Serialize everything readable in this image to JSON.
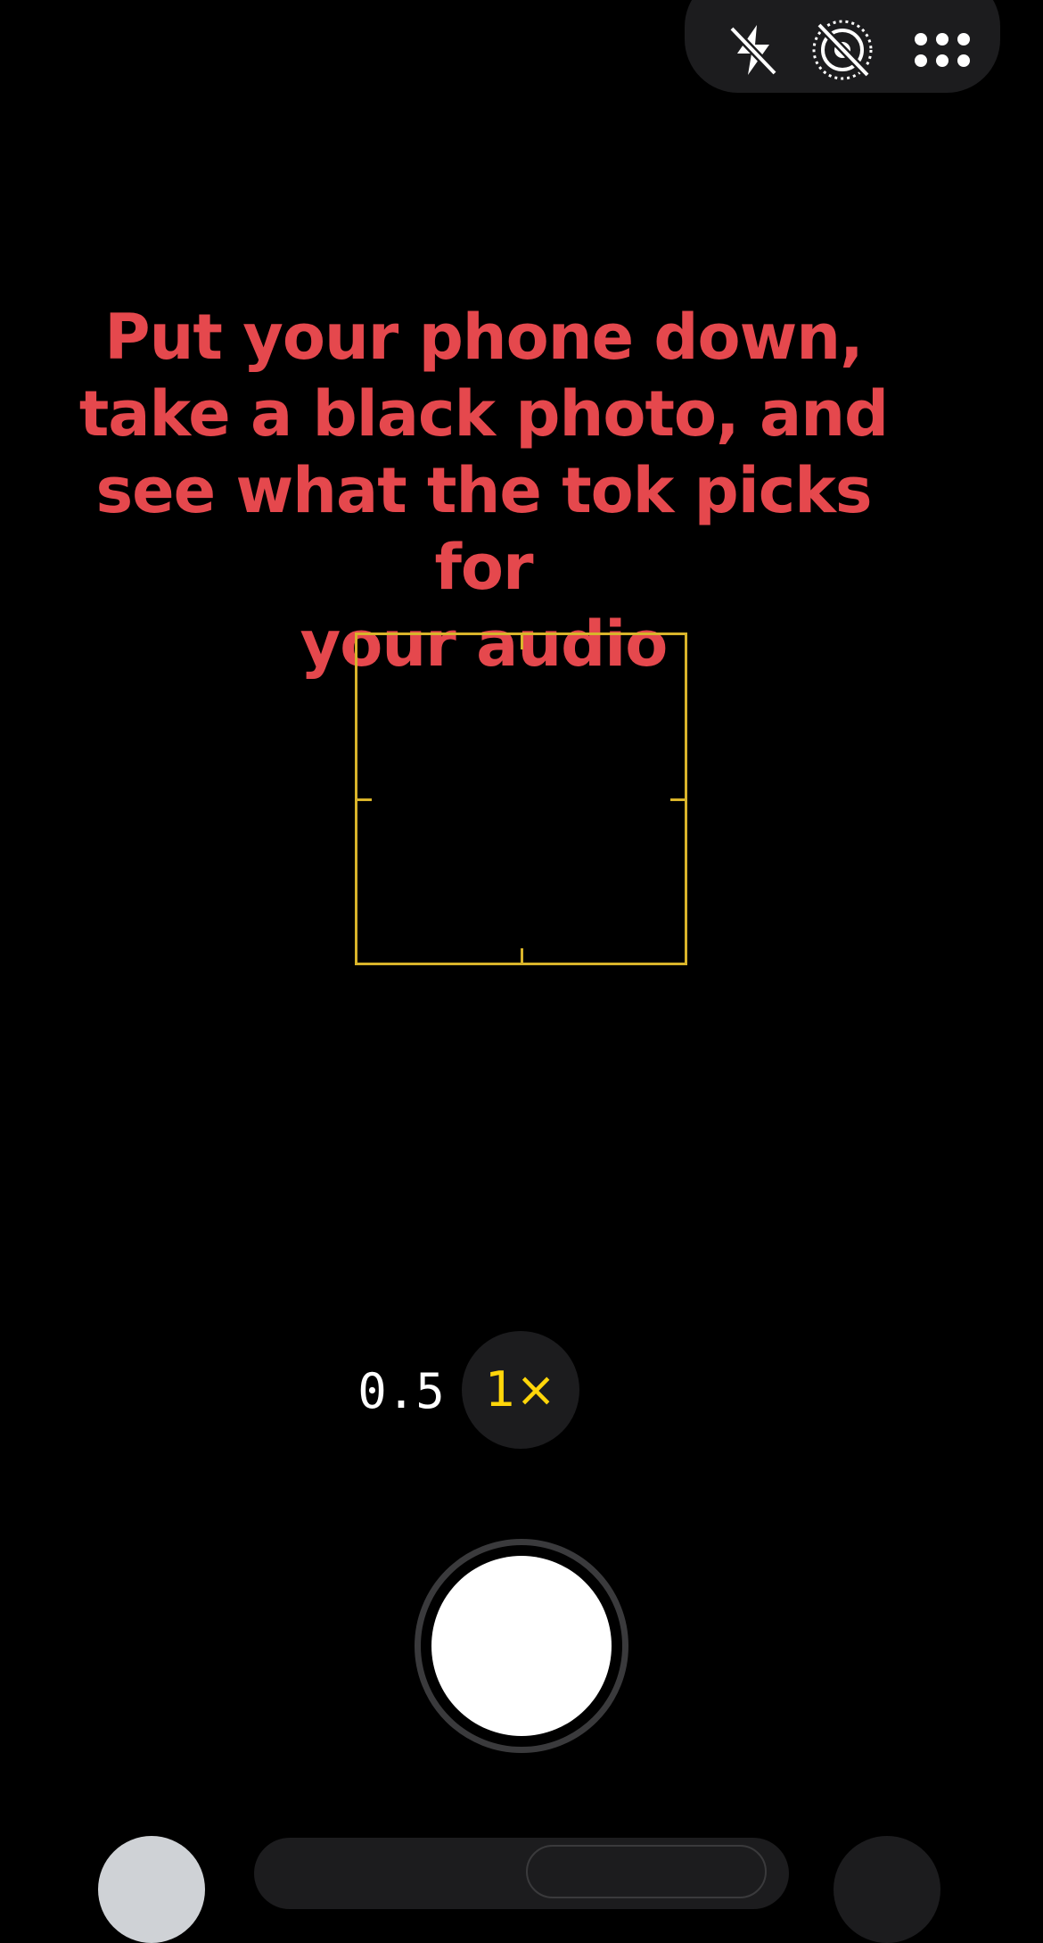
{
  "app": "Camera",
  "top_controls": {
    "icons": [
      "flash-off-icon",
      "live-photo-off-icon",
      "more-options-icon"
    ]
  },
  "overlay": {
    "lines": [
      "Put your phone down,",
      "take a black photo, and",
      "see what the tok picks for",
      "your audio"
    ]
  },
  "zoom": {
    "half": "0.5",
    "one": "1×",
    "selected": "1×"
  },
  "colors": {
    "background": "#000000",
    "overlay_text": "#e5484d",
    "focus_box": "#d9b42a",
    "zoom_active": "#ffd60a",
    "control_bg": "#1c1c1e"
  }
}
